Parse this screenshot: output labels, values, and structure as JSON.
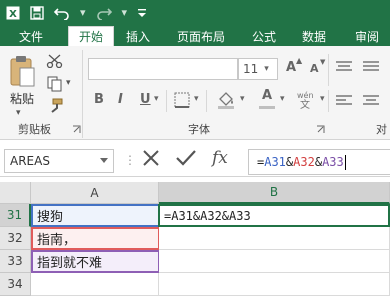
{
  "tabs": {
    "file": "文件",
    "home": "开始",
    "insert": "插入",
    "layout": "页面布局",
    "formulas": "公式",
    "data": "数据",
    "review": "审阅"
  },
  "ribbon": {
    "paste_label": "粘贴",
    "clipboard_group": "剪贴板",
    "font_group": "字体",
    "font_size": "11",
    "align_group_partial": "对",
    "bold": "B",
    "italic": "I",
    "underline": "U",
    "grow_font": "A",
    "shrink_font": "A",
    "font_color": "A"
  },
  "formula_bar": {
    "name_box": "AREAS",
    "fx_label": "fx",
    "formula": {
      "eq": "=",
      "ref1": "A31",
      "amp1": "&",
      "ref2": "A32",
      "amp2": "&",
      "ref3": "A33"
    }
  },
  "grid": {
    "columns": [
      "A",
      "B"
    ],
    "rows": [
      "31",
      "32",
      "33",
      "34"
    ],
    "cells": {
      "A31": "搜狗",
      "A32": "指南，",
      "A33": "指到就不难",
      "B31": "=A31&A32&A33"
    }
  },
  "colors": {
    "brand": "#217346",
    "ref_blue": "#4472c4",
    "ref_red": "#e05b5b",
    "ref_purple": "#8e5fb5"
  }
}
